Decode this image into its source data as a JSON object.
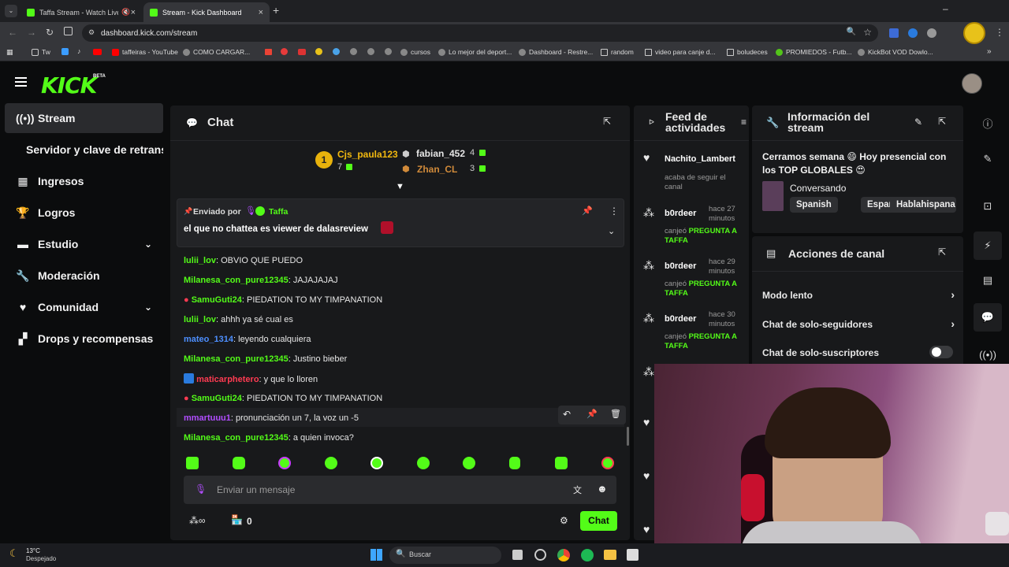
{
  "browser": {
    "tabs": [
      {
        "title": "Taffa Stream - Watch Live o"
      },
      {
        "title": "Stream - Kick Dashboard"
      }
    ],
    "url": "dashboard.kick.com/stream",
    "bookmarks": [
      "Tw",
      "taffeiras - YouTube",
      "COMO CARGAR...",
      "cursos",
      "Lo mejor del deport...",
      "Dashboard - Restre...",
      "random",
      "video para canje d...",
      "boludeces",
      "PROMIEDOS - Futb...",
      "KickBot VOD Dowlo..."
    ]
  },
  "header": {
    "logo": "KICK",
    "beta": "BETA"
  },
  "sidebar": {
    "items": [
      {
        "label": "Stream",
        "icon": "broadcast-icon"
      },
      {
        "label": "Servidor y clave de retransn",
        "icon": ""
      },
      {
        "label": "Ingresos",
        "icon": "dollar-icon"
      },
      {
        "label": "Logros",
        "icon": "trophy-icon"
      },
      {
        "label": "Estudio",
        "icon": "studio-icon"
      },
      {
        "label": "Moderación",
        "icon": "wrench-icon"
      },
      {
        "label": "Comunidad",
        "icon": "community-icon"
      },
      {
        "label": "Drops y recompensas",
        "icon": "gift-icon"
      }
    ]
  },
  "chat": {
    "title": "Chat",
    "leaderboard": {
      "first": {
        "name": "Cjs_paula123",
        "count": "7",
        "rank": "1"
      },
      "second": {
        "name": "fabian_452",
        "count": "4"
      },
      "third": {
        "name": "Zhan_CL",
        "count": "3"
      }
    },
    "pinned": {
      "sent_by_label": "Enviado por",
      "author": "Taffa",
      "message": "el que no chattea es viewer de dalasreview"
    },
    "messages": [
      {
        "user": "lulii_lov",
        "text": "OBVIO QUE PUEDO",
        "color": "#53fc18"
      },
      {
        "user": "Milanesa_con_pure12345",
        "text": "JAJAJAJAJ",
        "color": "#53fc18"
      },
      {
        "user": "SamuGuti24",
        "text": "PIEDATION TO MY TIMPANATION",
        "color": "#53fc18"
      },
      {
        "user": "lulii_lov",
        "text": "ahhh ya sé cual es",
        "color": "#53fc18"
      },
      {
        "user": "mateo_1314",
        "text": "leyendo cualquiera",
        "color": "#4d8fff"
      },
      {
        "user": "Milanesa_con_pure12345",
        "text": "Justino bieber",
        "color": "#53fc18"
      },
      {
        "user": "maticarphetero",
        "text": "y que lo lloren",
        "color": "#ff3b52"
      },
      {
        "user": "SamuGuti24",
        "text": "PIEDATION TO MY TIMPANATION",
        "color": "#53fc18"
      },
      {
        "user": "mmartuuu1",
        "text": "pronunciación un 7, la voz un -5",
        "color": "#b14dff"
      },
      {
        "user": "Milanesa_con_pure12345",
        "text": "a quien invoca?",
        "color": "#53fc18"
      }
    ],
    "input_placeholder": "Enviar un mensaje",
    "points": "0",
    "send_label": "Chat"
  },
  "feed": {
    "title": "Feed de actividades",
    "items": [
      {
        "name": "Nachito_Lambert",
        "action": "acaba de seguir el canal",
        "time": "",
        "kind": "follow"
      },
      {
        "name": "b0rdeer",
        "time": "hace 27 minutos",
        "action_prefix": "canjeó",
        "action": "PREGUNTA A TAFFA",
        "kind": "redeem"
      },
      {
        "name": "b0rdeer",
        "time": "hace 29 minutos",
        "action_prefix": "canjeó",
        "action": "PREGUNTA A TAFFA",
        "kind": "redeem"
      },
      {
        "name": "b0rdeer",
        "time": "hace 30 minutos",
        "action_prefix": "canjeó",
        "action": "PREGUNTA A TAFFA",
        "kind": "redeem"
      }
    ]
  },
  "info": {
    "title": "Información del stream",
    "stream_title": "Cerramos semana 😄 Hoy presencial con los TOP GLOBALES 😍",
    "category": "Conversando",
    "tags": [
      "Spanish",
      "Español",
      "Hablahispana"
    ]
  },
  "actions": {
    "title": "Acciones de canal",
    "items": [
      {
        "label": "Modo lento",
        "type": "link"
      },
      {
        "label": "Chat de solo-seguidores",
        "type": "link"
      },
      {
        "label": "Chat de solo-suscriptores",
        "type": "toggle",
        "on": false
      }
    ]
  },
  "taskbar": {
    "weather_temp": "13°C",
    "weather_desc": "Despejado",
    "search": "Buscar"
  },
  "colors": {
    "accent": "#53fc18",
    "panel": "#18191b",
    "bg": "#0b0c0d"
  }
}
